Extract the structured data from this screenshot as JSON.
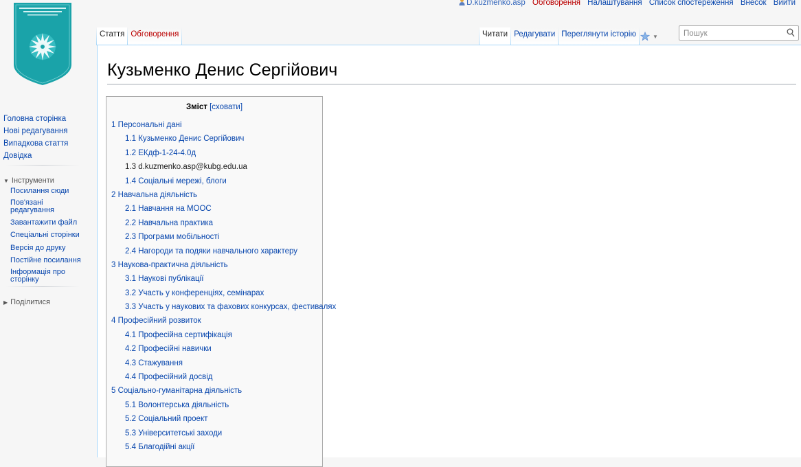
{
  "personal": {
    "user": "D.kuzmenko.asp",
    "talk": "Обговорення",
    "preferences": "Налаштування",
    "watchlist": "Список спостереження",
    "contributions": "Внесок",
    "logout": "Вийти"
  },
  "tabs": {
    "article": "Стаття",
    "discussion": "Обговорення",
    "read": "Читати",
    "edit": "Редагувати",
    "history": "Переглянути історію"
  },
  "search": {
    "placeholder": "Пошук"
  },
  "page": {
    "title": "Кузьменко Денис Сергійович"
  },
  "toc": {
    "title": "Зміст",
    "toggle": "[сховати]",
    "items": [
      {
        "num": "1",
        "text": "Персональні дані"
      },
      {
        "num": "1.1",
        "text": "Кузьменко Денис Сергійович"
      },
      {
        "num": "1.2",
        "text": "ЕКдф-1-24-4.0д"
      },
      {
        "num": "1.3",
        "text": "d.kuzmenko.asp@kubg.edu.ua"
      },
      {
        "num": "1.4",
        "text": "Соціальні мережі, блоги"
      },
      {
        "num": "2",
        "text": "Навчальна діяльність"
      },
      {
        "num": "2.1",
        "text": "Навчання на MOOC"
      },
      {
        "num": "2.2",
        "text": "Навчальна практика"
      },
      {
        "num": "2.3",
        "text": "Програми мобільності"
      },
      {
        "num": "2.4",
        "text": "Нагороди та подяки навчального характеру"
      },
      {
        "num": "3",
        "text": "Наукова-практична діяльність"
      },
      {
        "num": "3.1",
        "text": "Наукові публікації"
      },
      {
        "num": "3.2",
        "text": "Участь у конференціях, семінарах"
      },
      {
        "num": "3.3",
        "text": "Участь у наукових та фахових конкурсах, фестивалях"
      },
      {
        "num": "4",
        "text": "Професійний розвиток"
      },
      {
        "num": "4.1",
        "text": "Професійна сертифікація"
      },
      {
        "num": "4.2",
        "text": "Професійні навички"
      },
      {
        "num": "4.3",
        "text": "Стажування"
      },
      {
        "num": "4.4",
        "text": "Професійний досвід"
      },
      {
        "num": "5",
        "text": "Соціально-гуманітарна діяльність"
      },
      {
        "num": "5.1",
        "text": "Волонтерська діяльність"
      },
      {
        "num": "5.2",
        "text": "Соціальний проект"
      },
      {
        "num": "5.3",
        "text": "Університетські заходи"
      },
      {
        "num": "5.4",
        "text": "Благодійні акції"
      }
    ]
  },
  "sidebar": {
    "nav": [
      "Головна сторінка",
      "Нові редагування",
      "Випадкова стаття",
      "Довідка"
    ],
    "tools_heading": "Інструменти",
    "tools": [
      "Посилання сюди",
      "Пов'язані редагування",
      "Завантажити файл",
      "Спеціальні сторінки",
      "Версія до друку",
      "Постійне посилання",
      "Інформація про сторінку"
    ],
    "share_heading": "Поділитися"
  },
  "colors": {
    "link": "#0645ad",
    "redlink": "#ba0000",
    "tab_border": "#a7d7f9",
    "logo_teal": "#1aa3a9"
  }
}
